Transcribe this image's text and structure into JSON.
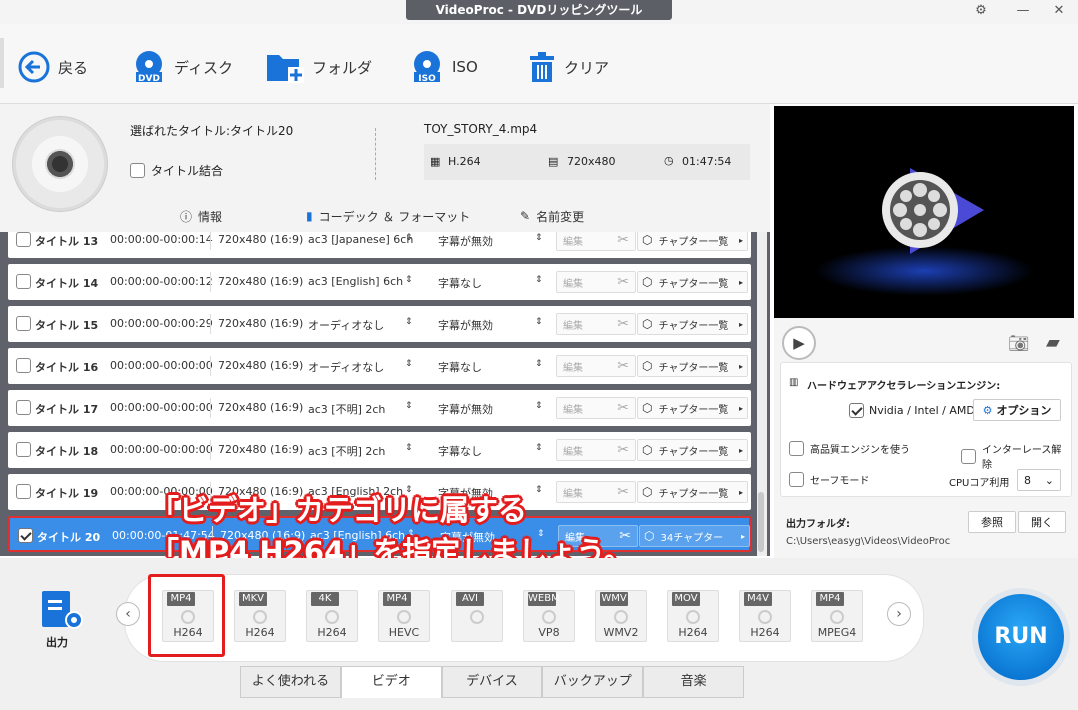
{
  "window": {
    "title": "VideoProc - DVDリッピングツール"
  },
  "toolbar": {
    "back": "戻る",
    "disc": "ディスク",
    "folder": "フォルダ",
    "iso": "ISO",
    "clear": "クリア"
  },
  "info": {
    "selected_title": "選ばれたタイトル:タイトル20",
    "merge_label": "タイトル結合",
    "filename": "TOY_STORY_4.mp4",
    "codec": "H.264",
    "resolution": "720x480",
    "duration": "01:47:54"
  },
  "subtabs": {
    "info": "情報",
    "codec": "コーデック ＆ フォーマット",
    "rename": "名前変更"
  },
  "rows": [
    {
      "title": "タイトル 13",
      "time": "00:00:00-00:00:14",
      "res": "720x480 (16:9)",
      "audio": "ac3 [Japanese] 6ch",
      "sub": "字幕が無効",
      "edit": "編集",
      "chap": "チャプター一覧"
    },
    {
      "title": "タイトル 14",
      "time": "00:00:00-00:00:12",
      "res": "720x480 (16:9)",
      "audio": "ac3 [English] 6ch",
      "sub": "字幕なし",
      "edit": "編集",
      "chap": "チャプター一覧"
    },
    {
      "title": "タイトル 15",
      "time": "00:00:00-00:00:29",
      "res": "720x480 (16:9)",
      "audio": "オーディオなし",
      "sub": "字幕が無効",
      "edit": "編集",
      "chap": "チャプター一覧"
    },
    {
      "title": "タイトル 16",
      "time": "00:00:00-00:00:00",
      "res": "720x480 (16:9)",
      "audio": "オーディオなし",
      "sub": "字幕なし",
      "edit": "編集",
      "chap": "チャプター一覧"
    },
    {
      "title": "タイトル 17",
      "time": "00:00:00-00:00:00",
      "res": "720x480 (16:9)",
      "audio": "ac3 [不明] 2ch",
      "sub": "字幕が無効",
      "edit": "編集",
      "chap": "チャプター一覧"
    },
    {
      "title": "タイトル 18",
      "time": "00:00:00-00:00:00",
      "res": "720x480 (16:9)",
      "audio": "ac3 [不明] 2ch",
      "sub": "字幕なし",
      "edit": "編集",
      "chap": "チャプター一覧"
    },
    {
      "title": "タイトル 19",
      "time": "00:00:00-00:00:00",
      "res": "720x480 (16:9)",
      "audio": "ac3 [English] 2ch",
      "sub": "字幕が無効",
      "edit": "編集",
      "chap": "チャプター一覧"
    },
    {
      "title": "タイトル 20",
      "time": "00:00:00-01:47:54",
      "res": "720x480 (16:9)",
      "audio": "ac3 [English] 6ch",
      "sub": "字幕が無効",
      "edit": "編集",
      "chap": "34チャプター"
    }
  ],
  "annotation": {
    "line1": "「ビデオ」カテゴリに属する",
    "line2": "「MP4 H264」を指定しましょう。"
  },
  "hw": {
    "label": "ハードウェアアクセラレーションエンジン:",
    "nvidia": "Nvidia / Intel / AMD",
    "option": "オプション",
    "hq": "高品質エンジンを使う",
    "deinterlace": "インターレース解除",
    "safe": "セーフモード",
    "cpu_label": "CPUコア利用",
    "cpu_value": "8"
  },
  "output": {
    "label": "出力フォルダ:",
    "browse": "参照",
    "open": "開く",
    "path": "C:\\Users\\easyg\\Videos\\VideoProc",
    "side_label": "出力"
  },
  "formats": [
    {
      "tag": "MP4",
      "codec": "H264"
    },
    {
      "tag": "MKV",
      "codec": "H264"
    },
    {
      "tag": "4K",
      "codec": "H264"
    },
    {
      "tag": "MP4",
      "codec": "HEVC"
    },
    {
      "tag": "AVI",
      "codec": ""
    },
    {
      "tag": "WEBM",
      "codec": "VP8"
    },
    {
      "tag": "WMV",
      "codec": "WMV2"
    },
    {
      "tag": "MOV",
      "codec": "H264"
    },
    {
      "tag": "M4V",
      "codec": "H264"
    },
    {
      "tag": "MP4",
      "codec": "MPEG4"
    }
  ],
  "tabs": [
    "よく使われる",
    "ビデオ",
    "デバイス",
    "バックアップ",
    "音楽"
  ],
  "run": "RUN"
}
